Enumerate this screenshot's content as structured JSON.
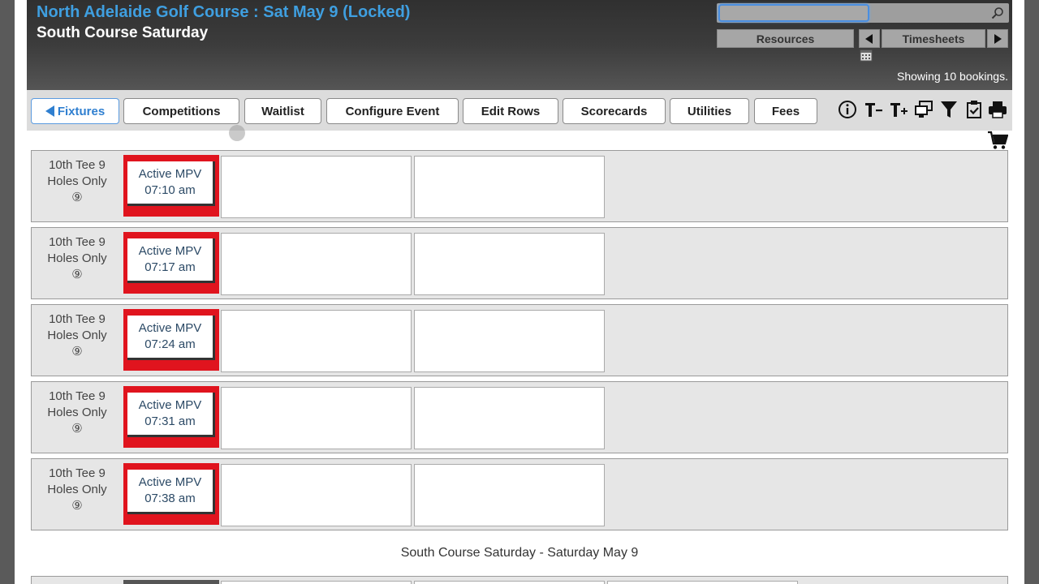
{
  "header": {
    "title": "North Adelaide Golf Course : Sat May 9 (Locked)",
    "subtitle": "South Course Saturday",
    "search_placeholder": "",
    "resources_label": "Resources",
    "timesheets_label": "Timesheets",
    "showing_text": "Showing 10 bookings."
  },
  "toolbar": {
    "buttons": [
      "Fixtures",
      "Competitions",
      "Waitlist",
      "Configure Event",
      "Edit Rows",
      "Scorecards",
      "Utilities",
      "Fees"
    ],
    "icons": [
      "info-icon",
      "text-decrease-icon",
      "text-increase-icon",
      "monitor-icon",
      "filter-icon",
      "checklist-icon",
      "print-icon"
    ]
  },
  "rows": [
    {
      "tee": "10th Tee 9",
      "holes": "Holes Only",
      "badge": "⑨",
      "status": "Active MPV",
      "time": "07:10 am"
    },
    {
      "tee": "10th Tee 9",
      "holes": "Holes Only",
      "badge": "⑨",
      "status": "Active MPV",
      "time": "07:17 am"
    },
    {
      "tee": "10th Tee 9",
      "holes": "Holes Only",
      "badge": "⑨",
      "status": "Active MPV",
      "time": "07:24 am"
    },
    {
      "tee": "10th Tee 9",
      "holes": "Holes Only",
      "badge": "⑨",
      "status": "Active MPV",
      "time": "07:31 am"
    },
    {
      "tee": "10th Tee 9",
      "holes": "Holes Only",
      "badge": "⑨",
      "status": "Active MPV",
      "time": "07:38 am"
    }
  ],
  "footer": {
    "section_title": "South Course Saturday - Saturday May 9"
  },
  "colors": {
    "title_blue": "#3f9fe0",
    "slot_red": "#e0141e",
    "header_dark": "#303030"
  }
}
